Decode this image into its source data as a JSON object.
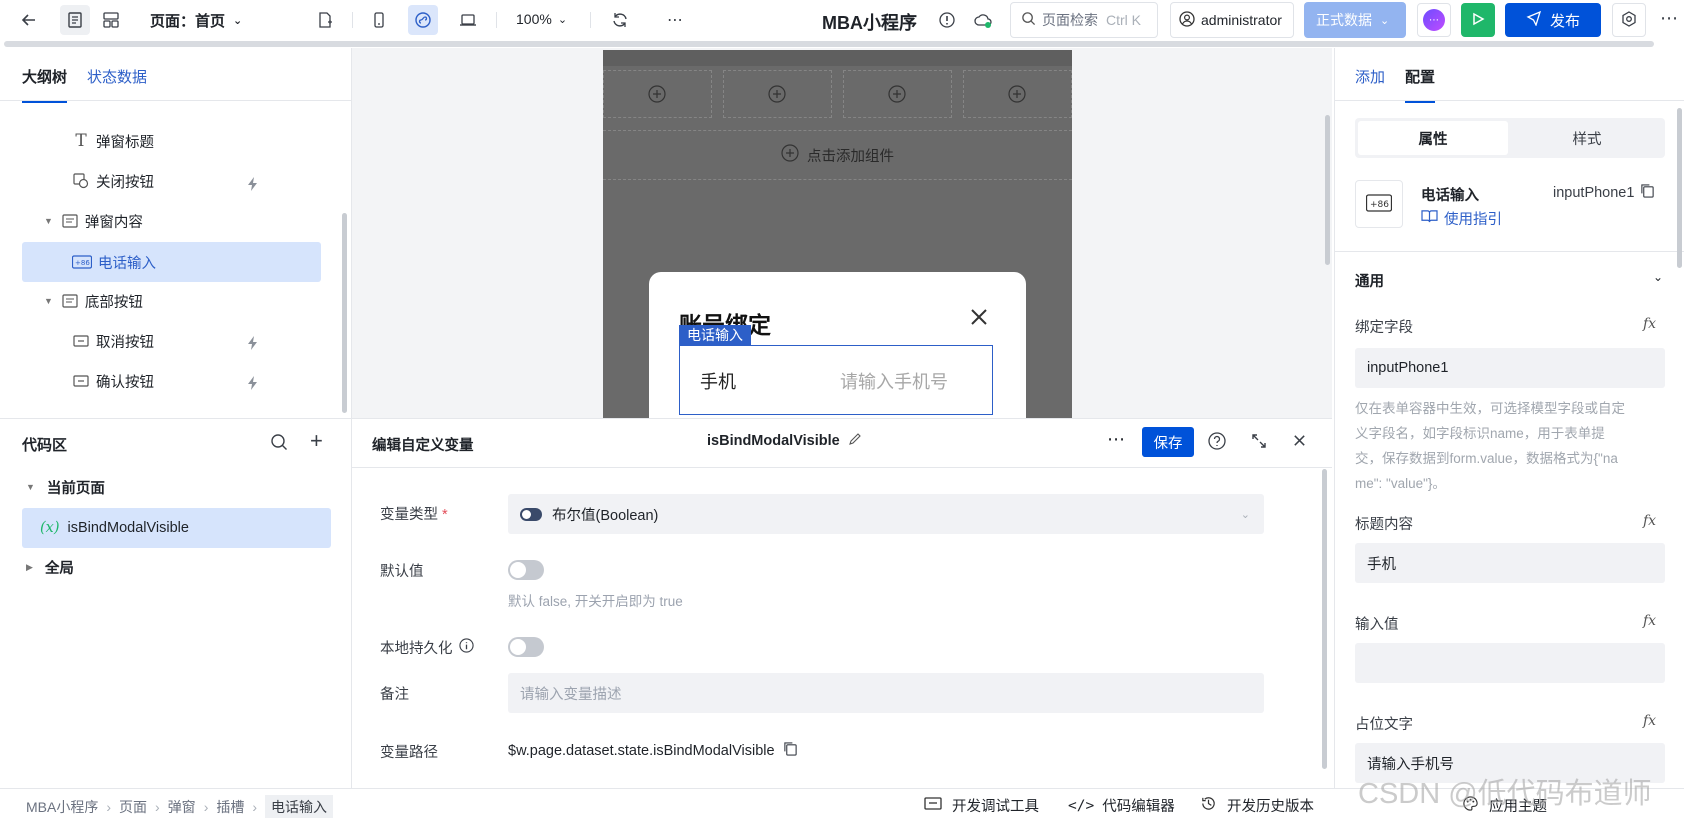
{
  "topbar": {
    "page_label": "页面：首页",
    "zoom": "100%",
    "app_title": "MBA小程序",
    "search_placeholder": "页面检索",
    "search_shortcut": "Ctrl K",
    "user": "administrator",
    "env_button": "正式数据",
    "publish_button": "发布"
  },
  "left": {
    "tabs": [
      "大纲树",
      "状态数据"
    ],
    "tree": [
      {
        "label": "弹窗标题"
      },
      {
        "label": "关闭按钮"
      },
      {
        "label": "弹窗内容"
      },
      {
        "label": "电话输入"
      },
      {
        "label": "底部按钮"
      },
      {
        "label": "取消按钮"
      },
      {
        "label": "确认按钮"
      }
    ],
    "code_area_title": "代码区",
    "code_tree": {
      "current_page": "当前页面",
      "variable_icon": "(x)",
      "variable": "isBindModalVisible",
      "global": "全局"
    }
  },
  "canvas": {
    "add_component": "点击添加组件",
    "modal_title": "账号绑定",
    "selected_tag": "电话输入",
    "field_label": "手机",
    "field_placeholder": "请输入手机号"
  },
  "editor": {
    "title": "编辑自定义变量",
    "var_name": "isBindModalVisible",
    "save": "保存",
    "type_label": "变量类型",
    "required_mark": "*",
    "type_value": "布尔值(Boolean)",
    "default_label": "默认值",
    "default_hint": "默认 false, 开关开启即为 true",
    "persist_label": "本地持久化",
    "remark_label": "备注",
    "remark_placeholder": "请输入变量描述",
    "path_label": "变量路径",
    "path_value": "$w.page.dataset.state.isBindModalVisible"
  },
  "right": {
    "tabs": [
      "添加",
      "配置"
    ],
    "seg": [
      "属性",
      "样式"
    ],
    "component_icon_text": "+86",
    "component_name": "电话输入",
    "component_id": "inputPhone1",
    "guide_link": "使用指引",
    "section_title": "通用",
    "bind_field_label": "绑定字段",
    "bind_field_value": "inputPhone1",
    "bind_hint_1": "仅在表单容器中生效，可选择模型字段或自定",
    "bind_hint_2": "义字段名，如字段标识name，用于表单提",
    "bind_hint_3": "交，保存数据到form.value，数据格式为{\"na",
    "bind_hint_4": "me\": \"value\"}。",
    "title_label": "标题内容",
    "title_value": "手机",
    "input_value_label": "输入值",
    "placeholder_label": "占位文字",
    "placeholder_value": "请输入手机号",
    "fx": "fx"
  },
  "status": {
    "breadcrumb": [
      "MBA小程序",
      "页面",
      "弹窗",
      "插槽",
      "电话输入"
    ],
    "devtools": "开发调试工具",
    "code_editor": "代码编辑器",
    "history": "开发历史版本",
    "theme": "应用主题"
  },
  "watermark": "CSDN @低代码布道师"
}
